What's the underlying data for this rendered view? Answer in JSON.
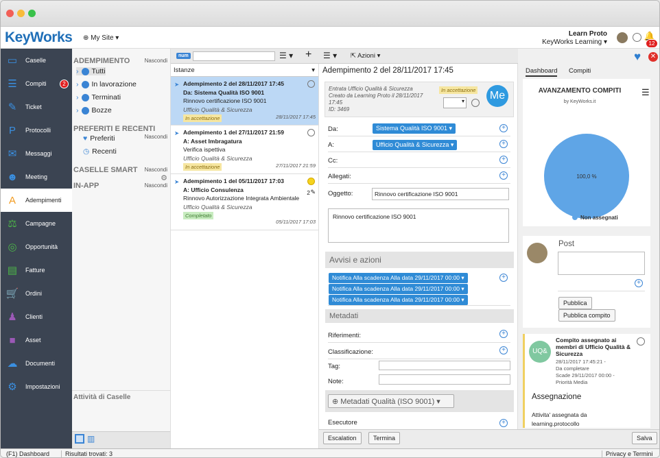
{
  "app": {
    "logo": "KeyWorks",
    "site": "My Site ▾",
    "user_name": "Learn Proto",
    "org": "KeyWorks Learning ▾",
    "notif_count": "12"
  },
  "sidebar": {
    "items": [
      {
        "label": "Caselle",
        "icon": "inbox-icon",
        "glyph": "▭"
      },
      {
        "label": "Compiti",
        "icon": "tasks-icon",
        "glyph": "☰",
        "badge": "2"
      },
      {
        "label": "Ticket",
        "icon": "ticket-icon",
        "glyph": "✎"
      },
      {
        "label": "Protocolli",
        "icon": "protocol-icon",
        "glyph": "P"
      },
      {
        "label": "Messaggi",
        "icon": "mail-icon",
        "glyph": "✉"
      },
      {
        "label": "Meeting",
        "icon": "people-icon",
        "glyph": "☻"
      },
      {
        "label": "Adempimenti",
        "icon": "compliance-icon",
        "glyph": "A"
      },
      {
        "label": "Campagne",
        "icon": "campaign-icon",
        "glyph": "⚖"
      },
      {
        "label": "Opportunità",
        "icon": "target-icon",
        "glyph": "◎"
      },
      {
        "label": "Fatture",
        "icon": "invoice-icon",
        "glyph": "▤"
      },
      {
        "label": "Ordini",
        "icon": "cart-icon",
        "glyph": "🛒"
      },
      {
        "label": "Clienti",
        "icon": "person-icon",
        "glyph": "♟"
      },
      {
        "label": "Asset",
        "icon": "box-icon",
        "glyph": "■"
      },
      {
        "label": "Documenti",
        "icon": "cloud-icon",
        "glyph": "☁"
      },
      {
        "label": "Impostazioni",
        "icon": "gear-icon",
        "glyph": "⚙"
      }
    ]
  },
  "nav": {
    "adempimento_title": "ADEMPIMENTO",
    "hide": "Nascondi",
    "adempimento_items": [
      "Tutti",
      "In lavorazione",
      "Terminati",
      "Bozze"
    ],
    "preferiti_title": "PREFERITI E RECENTI",
    "preferiti_items": [
      "Preferiti",
      "Recenti"
    ],
    "smart_title": "CASELLE SMART",
    "inapp_title": "IN-APP",
    "activity_title": "Attività di Caselle"
  },
  "list": {
    "num_label": "num",
    "actions": "Azioni",
    "header": "Istanze",
    "cards": [
      {
        "title": "Adempimento 2 del 28/11/2017 17:45",
        "from": "Da: Sistema Qualità ISO 9001",
        "subject": "Rinnovo certificazione ISO 9001",
        "office": "Ufficio Qualità & Sicurezza",
        "status": "In accettazione",
        "date": "28/11/2017 17:45",
        "count": ""
      },
      {
        "title": "Adempimento 1 del 27/11/2017 21:59",
        "from": "A: Asset Imbragatura",
        "subject": "Verifica ispettiva",
        "office": "Ufficio Qualità & Sicurezza",
        "status": "In accettazione",
        "date": "27/11/2017 21:59",
        "count": ""
      },
      {
        "title": "Adempimento 1 del 05/11/2017 17:03",
        "from": "A: Ufficio Consulenza",
        "subject": "Rinnovo Autorizzazione Integrata Ambientale",
        "office": "Ufficio Qualità & Sicurezza",
        "status": "Completato",
        "date": "05/11/2017 17:03",
        "count": "2"
      }
    ]
  },
  "detail": {
    "title": "Adempimento 2 del 28/11/2017 17:45",
    "info1": "Entrata Ufficio Qualità & Sicurezza",
    "info2": "Creato da Learning Proto il 28/11/2017",
    "info3": "17:45",
    "info4": "ID: 3469",
    "status": "In accettazione",
    "avatar": "Me",
    "da_label": "Da:",
    "da_value": "Sistema Qualità ISO 9001 ▾",
    "a_label": "A:",
    "a_value": "Ufficio Qualità & Sicurezza ▾",
    "cc_label": "Cc:",
    "allegati_label": "Allegati:",
    "oggetto_label": "Oggetto:",
    "oggetto_value": "Rinnovo certificazione ISO 9001",
    "body": "Rinnovo certificazione ISO 9001",
    "avvisi_title": "Avvisi e azioni",
    "notifiche": [
      "Notifica Alla scadenza Alla data 29/11/2017 00:00 ▾",
      "Notifica Alla scadenza Alla data 29/11/2017 00:00 ▾",
      "Notifica Alla scadenza Alla data 29/11/2017 00:00 ▾"
    ],
    "metadati_title": "Metadati",
    "riferimenti": "Riferimenti:",
    "classificazione": "Classificazione:",
    "tag": "Tag:",
    "note": "Note:",
    "metadati_qualita": "Metadati Qualità (ISO 9001)",
    "esecutore": "Esecutore",
    "escalation": "Escalation",
    "termina": "Termina",
    "salva": "Salva"
  },
  "right": {
    "tab_dashboard": "Dashboard",
    "tab_compiti": "Compiti",
    "chart_title": "AVANZAMENTO COMPITI",
    "chart_sub": "by KeyWorks.it",
    "pie_label": "100,0 %",
    "legend": "Non assegnati",
    "post_title": "Post",
    "publish": "Pubblica",
    "publish_task": "Pubblica compito",
    "feed_avatar": "UQ&",
    "feed_title": "Compito assegnato ai membri di Ufficio Qualità & Sicurezza",
    "feed_line1": "28/11/2017 17:45:21 -",
    "feed_line2": "Da completare",
    "feed_line3": "Scade 29/11/2017 00:00 -",
    "feed_line4": "Priorità Media",
    "feed_heading": "Assegnazione",
    "feed_text": "Attivita' assegnata da learning.protocollo"
  },
  "chart_data": {
    "type": "pie",
    "title": "AVANZAMENTO COMPITI",
    "subtitle": "by KeyWorks.it",
    "categories": [
      "Non assegnati"
    ],
    "values": [
      100.0
    ],
    "colors": [
      "#5fa5e6"
    ],
    "legend": "bottom"
  },
  "status": {
    "left": "(F1) Dashboard",
    "results": "Risultati trovati: 3",
    "right": "Privacy e Termini"
  },
  "colors": {
    "accent": "#2f8bd6",
    "sidebar": "#3b4452",
    "selected": "#bcd8f5"
  }
}
